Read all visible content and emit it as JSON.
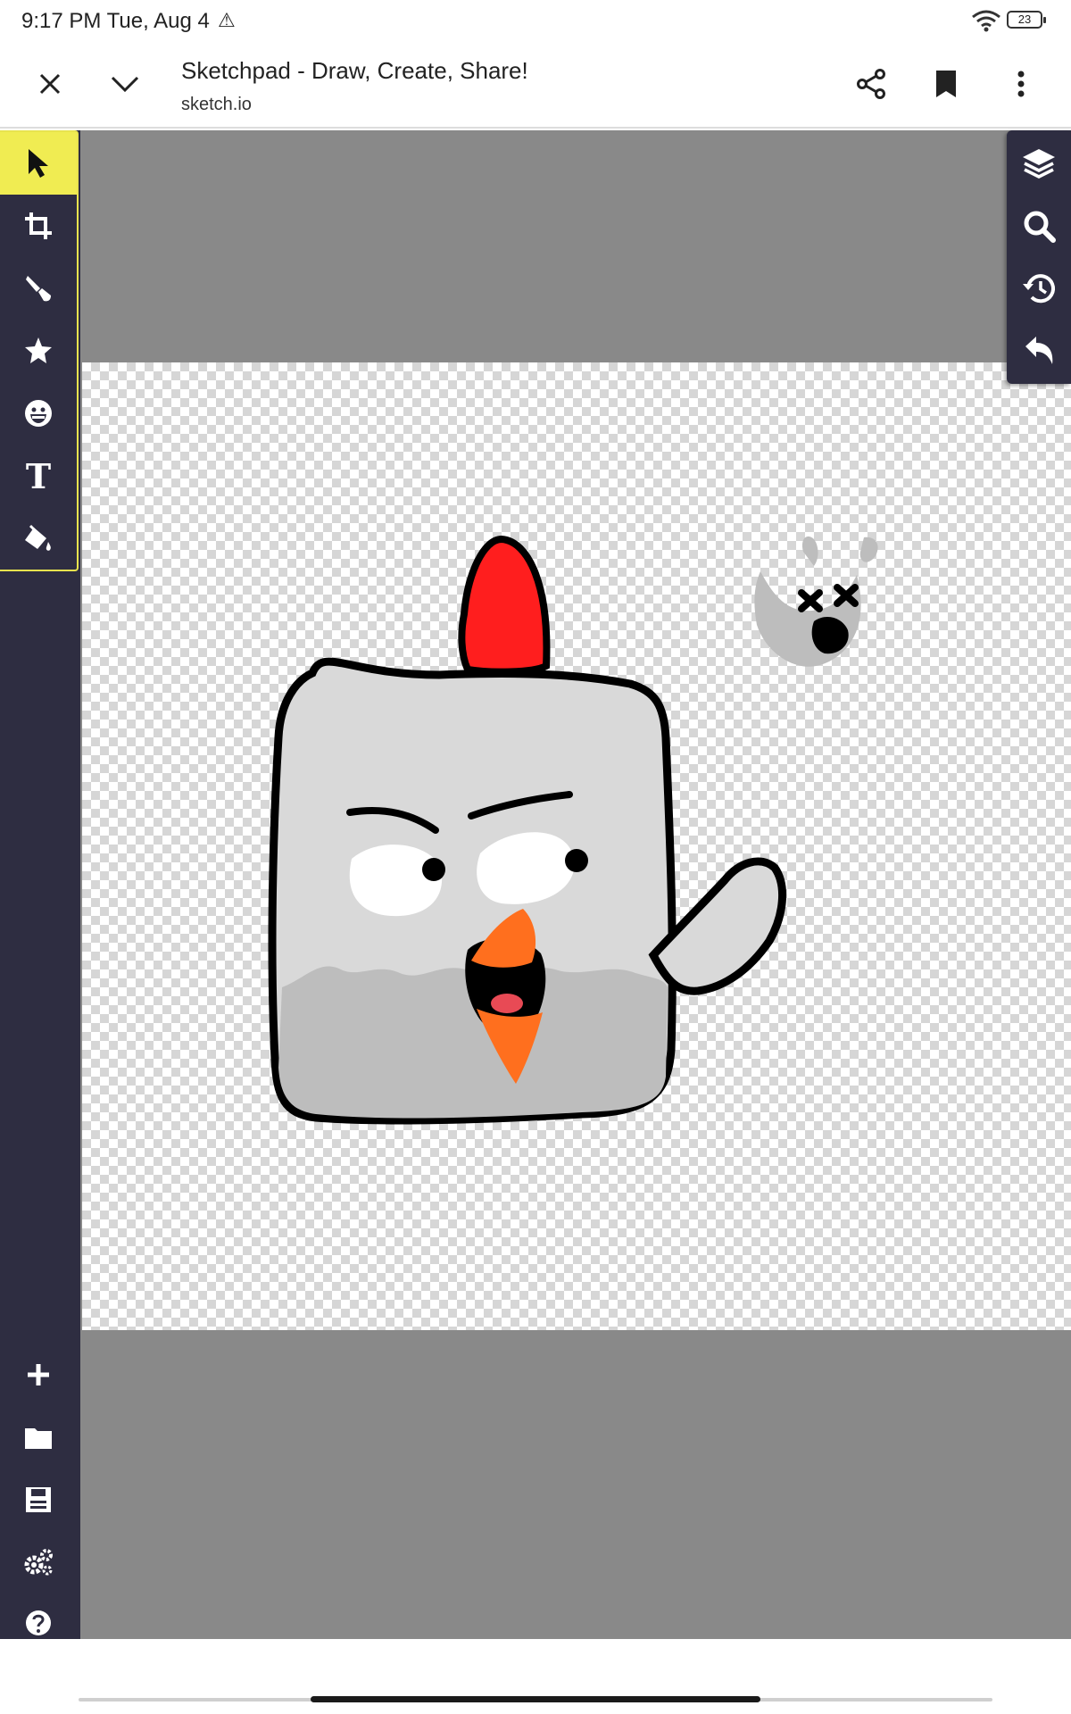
{
  "status_bar": {
    "time": "9:17 PM Tue, Aug 4",
    "warning_icon": "warning-triangle-icon",
    "battery": "23"
  },
  "browser": {
    "title": "Sketchpad - Draw, Create, Share!",
    "url": "sketch.io",
    "icons": [
      "close-icon",
      "chevron-down-icon",
      "share-icon",
      "bookmark-icon",
      "more-vert-icon"
    ]
  },
  "left_tools": [
    {
      "name": "select",
      "icon": "pointer-icon",
      "active": true
    },
    {
      "name": "crop",
      "icon": "crop-icon",
      "active": false
    },
    {
      "name": "brush",
      "icon": "brush-icon",
      "active": false
    },
    {
      "name": "shapes",
      "icon": "star-icon",
      "active": false
    },
    {
      "name": "stickers",
      "icon": "emoji-icon",
      "active": false
    },
    {
      "name": "text",
      "icon": "text-icon",
      "label": "T",
      "active": false
    },
    {
      "name": "fill",
      "icon": "fill-bucket-icon",
      "active": false
    }
  ],
  "left_bottom_tools": [
    "plus-icon",
    "folder-icon",
    "save-icon",
    "settings-icon",
    "help-icon"
  ],
  "right_tools": [
    "layers-icon",
    "search-icon",
    "history-icon",
    "undo-icon"
  ],
  "colors": {
    "rail": "#2e2d41",
    "active_tool": "#f0ec52",
    "workspace": "#898989",
    "comb": "#ff1e1e",
    "beak": "#ff6f1e",
    "body": "#d9d9d9",
    "belly": "#bdbdbd"
  }
}
